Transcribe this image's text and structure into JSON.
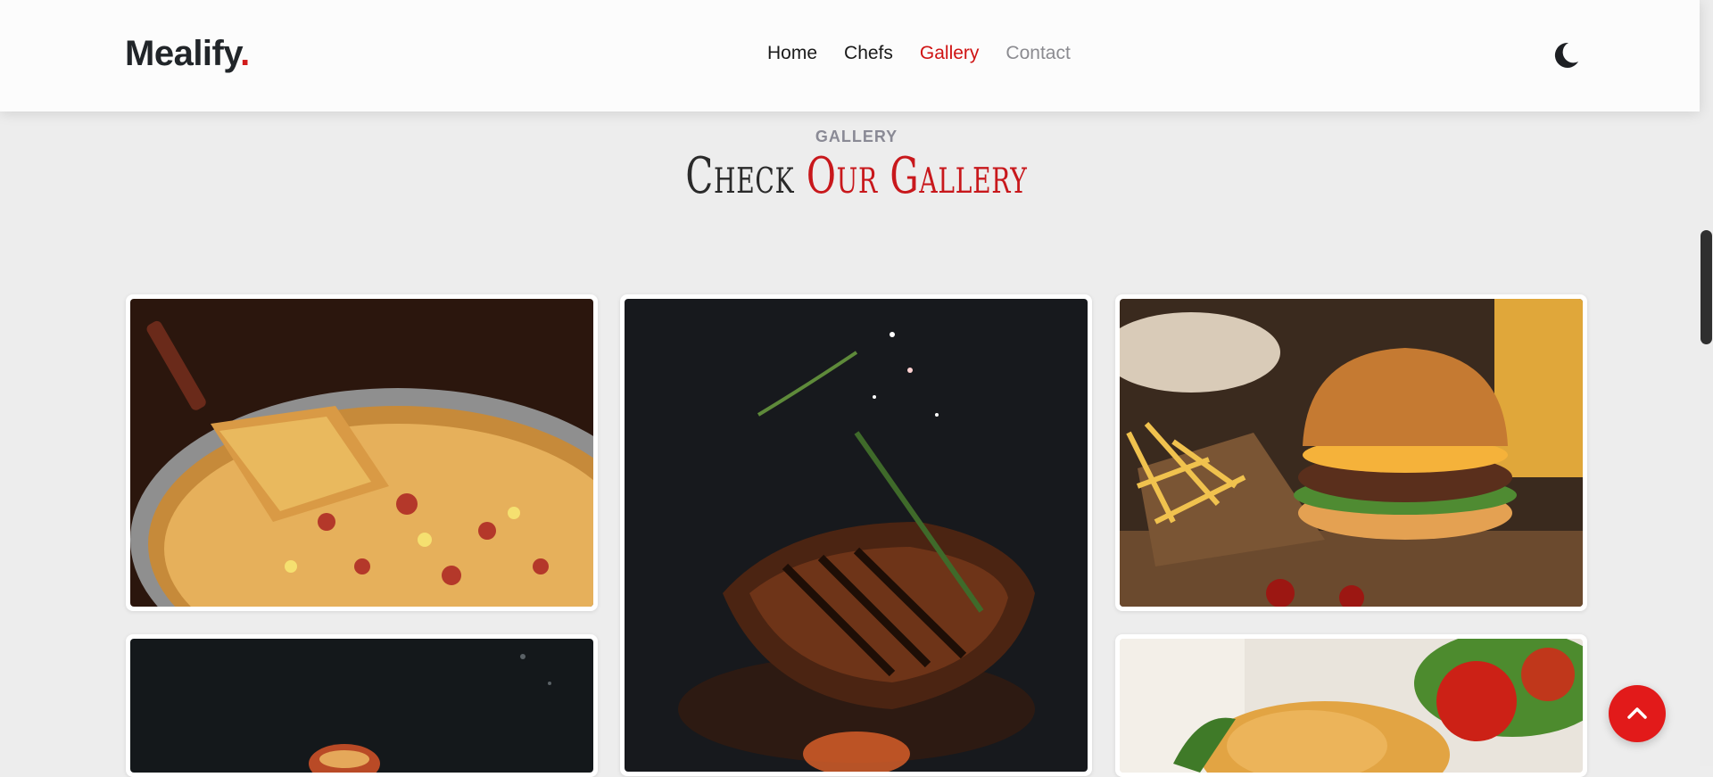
{
  "brand": {
    "name": "Mealify",
    "dot": "."
  },
  "nav": [
    {
      "label": "Home",
      "state": "default"
    },
    {
      "label": "Chefs",
      "state": "default"
    },
    {
      "label": "Gallery",
      "state": "active"
    },
    {
      "label": "Contact",
      "state": "muted"
    }
  ],
  "section": {
    "label": "GALLERY",
    "title_part1": "Check ",
    "title_part2": "Our Gallery"
  },
  "gallery": {
    "images": [
      "pizza",
      "grilled-steak",
      "burger-and-fries",
      "food-dark",
      "fried-chicken"
    ]
  },
  "icons": {
    "theme_toggle": "moon-icon",
    "back_to_top": "chevron-up-icon"
  },
  "colors": {
    "accent": "#cf1313",
    "text": "#212529",
    "muted": "#8b8b90",
    "background": "#ededed"
  }
}
